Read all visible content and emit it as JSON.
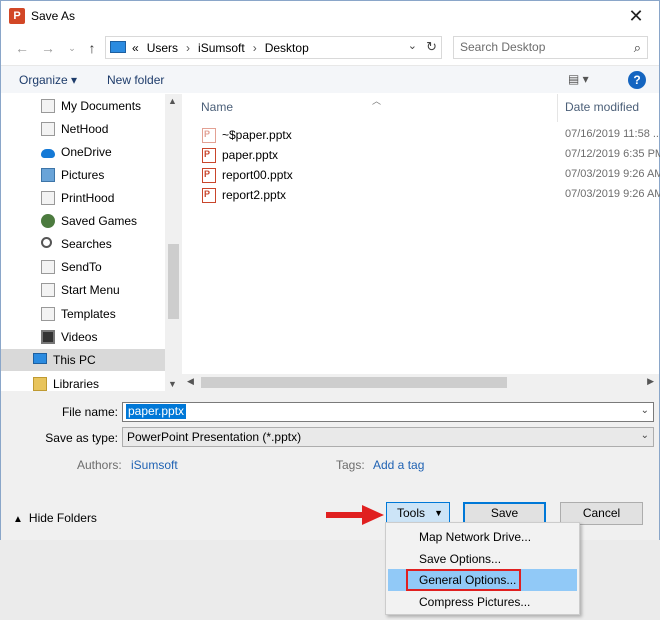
{
  "window": {
    "title": "Save As",
    "app_icon": "P"
  },
  "address": {
    "crumbs": [
      "«",
      "Users",
      "iSumsoft",
      "Desktop"
    ],
    "search_placeholder": "Search Desktop"
  },
  "commandbar": {
    "organize": "Organize ▾",
    "new_folder": "New folder",
    "help": "?"
  },
  "nav": {
    "items": [
      {
        "label": "My Documents",
        "icon": "shortcut-icon"
      },
      {
        "label": "NetHood",
        "icon": "shortcut-icon"
      },
      {
        "label": "OneDrive",
        "icon": "cloud-icon"
      },
      {
        "label": "Pictures",
        "icon": "pictures-icon"
      },
      {
        "label": "PrintHood",
        "icon": "shortcut-icon"
      },
      {
        "label": "Saved Games",
        "icon": "games-icon"
      },
      {
        "label": "Searches",
        "icon": "search-icon"
      },
      {
        "label": "SendTo",
        "icon": "shortcut-icon"
      },
      {
        "label": "Start Menu",
        "icon": "shortcut-icon"
      },
      {
        "label": "Templates",
        "icon": "shortcut-icon"
      },
      {
        "label": "Videos",
        "icon": "video-icon"
      },
      {
        "label": "This PC",
        "icon": "pc-icon"
      },
      {
        "label": "Libraries",
        "icon": "library-icon"
      }
    ]
  },
  "filelist": {
    "columns": {
      "name": "Name",
      "date": "Date modified"
    },
    "files": [
      {
        "name": "~$paper.pptx",
        "date": "07/16/2019 11:58 ..."
      },
      {
        "name": "paper.pptx",
        "date": "07/12/2019 6:35 PM"
      },
      {
        "name": "report00.pptx",
        "date": "07/03/2019 9:26 AM"
      },
      {
        "name": "report2.pptx",
        "date": "07/03/2019 9:26 AM"
      }
    ]
  },
  "form": {
    "file_name_label": "File name:",
    "file_name_value": "paper.pptx",
    "save_type_label": "Save as type:",
    "save_type_value": "PowerPoint Presentation (*.pptx)",
    "authors_label": "Authors:",
    "authors_value": "iSumsoft",
    "tags_label": "Tags:",
    "tags_value": "Add a tag"
  },
  "footer": {
    "hide_folders": "Hide Folders",
    "tools": "Tools",
    "save": "Save",
    "cancel": "Cancel"
  },
  "tools_menu": {
    "items": [
      "Map Network Drive...",
      "Save Options...",
      "General Options...",
      "Compress Pictures..."
    ],
    "highlighted_index": 2
  },
  "colors": {
    "accent": "#0078d7",
    "highlight_box": "#e02020",
    "arrow": "#e02020"
  }
}
